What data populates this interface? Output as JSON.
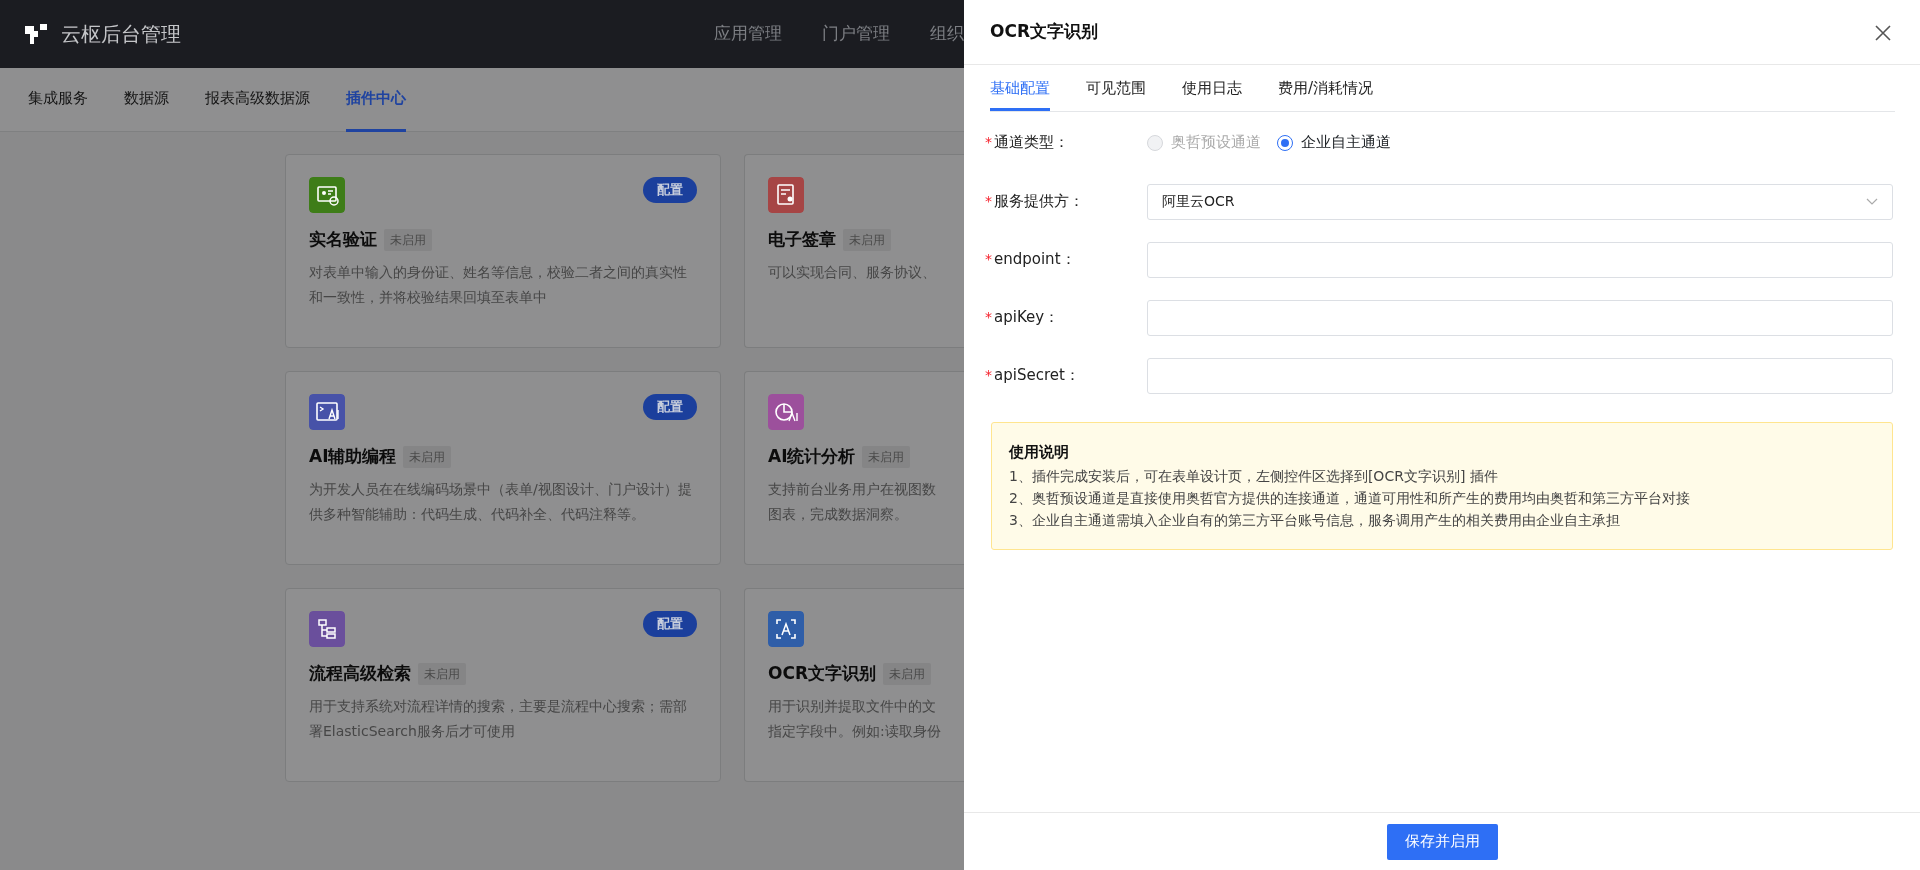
{
  "app": {
    "title": "云枢后台管理",
    "nav": [
      {
        "label": "应用管理"
      },
      {
        "label": "门户管理"
      },
      {
        "label": "组织"
      }
    ]
  },
  "subnav": [
    {
      "label": "集成服务",
      "selected": false
    },
    {
      "label": "数据源",
      "selected": false
    },
    {
      "label": "报表高级数据源",
      "selected": false
    },
    {
      "label": "插件中心",
      "selected": true
    }
  ],
  "plugins": [
    {
      "kind": "idcard",
      "color": "#3e7d18",
      "name": "实名验证",
      "status": "未启用",
      "action": "配置",
      "description_lines": [
        "对表单中输入的身份证、姓名等信息，校验二者之间的真实性和一致性，并将校验结果回填至表单中"
      ]
    },
    {
      "kind": "seal",
      "color": "#a64545",
      "name": "电子签章",
      "status": "未启用",
      "description_lines": [
        "可以实现合同、服务协议、"
      ]
    },
    {
      "kind": "code",
      "color": "#4752a8",
      "name": "AI辅助编程",
      "status": "未启用",
      "action": "配置",
      "description_lines": [
        "为开发人员在在线编码场景中（表单/视图设计、门户设计）提供多种智能辅助：代码生成、代码补全、代码注释等。"
      ]
    },
    {
      "kind": "chart",
      "color": "#9c509c",
      "name": "AI统计分析",
      "status": "未启用",
      "description_lines": [
        "支持前台业务用户在视图数",
        "图表，完成数据洞察。"
      ]
    },
    {
      "kind": "tree",
      "color": "#6a4f9c",
      "name": "流程高级检索",
      "status": "未启用",
      "action": "配置",
      "description_lines": [
        "用于支持系统对流程详情的搜索，主要是流程中心搜索；需部署ElasticSearch服务后才可使用"
      ]
    },
    {
      "kind": "scan",
      "color": "#2f5ea8",
      "name": "OCR文字识别",
      "status": "未启用",
      "description_lines": [
        "用于识别并提取文件中的文",
        "指定字段中。例如:读取身份"
      ]
    }
  ],
  "drawer": {
    "title": "OCR文字识别",
    "tabs": [
      {
        "label": "基础配置",
        "selected": true
      },
      {
        "label": "可见范围",
        "selected": false
      },
      {
        "label": "使用日志",
        "selected": false
      },
      {
        "label": "费用/消耗情况",
        "selected": false
      }
    ],
    "fields": [
      {
        "kind": "radio",
        "required_mark": "*",
        "label": "通道类型：",
        "options": [
          {
            "label": "奥哲预设通道",
            "selected": false,
            "disabled": true
          },
          {
            "label": "企业自主通道",
            "selected": true,
            "disabled": false
          }
        ]
      },
      {
        "kind": "select",
        "required_mark": "*",
        "label": "服务提供方：",
        "value": "阿里云OCR"
      },
      {
        "kind": "input",
        "required_mark": "*",
        "label": "endpoint："
      },
      {
        "kind": "input",
        "required_mark": "*",
        "label": "apiKey："
      },
      {
        "kind": "input",
        "required_mark": "*",
        "label": "apiSecret："
      }
    ],
    "notice": {
      "title": "使用说明",
      "lines": [
        "1、插件完成安装后，可在表单设计页，左侧控件区选择到[OCR文字识别] 插件",
        "2、奥哲预设通道是直接使用奥哲官方提供的连接通道，通道可用性和所产生的费用均由奥哲和第三方平台对接",
        "3、企业自主通道需填入企业自有的第三方平台账号信息，服务调用产生的相关费用由企业自主承担"
      ]
    },
    "submit": "保存并启用"
  }
}
